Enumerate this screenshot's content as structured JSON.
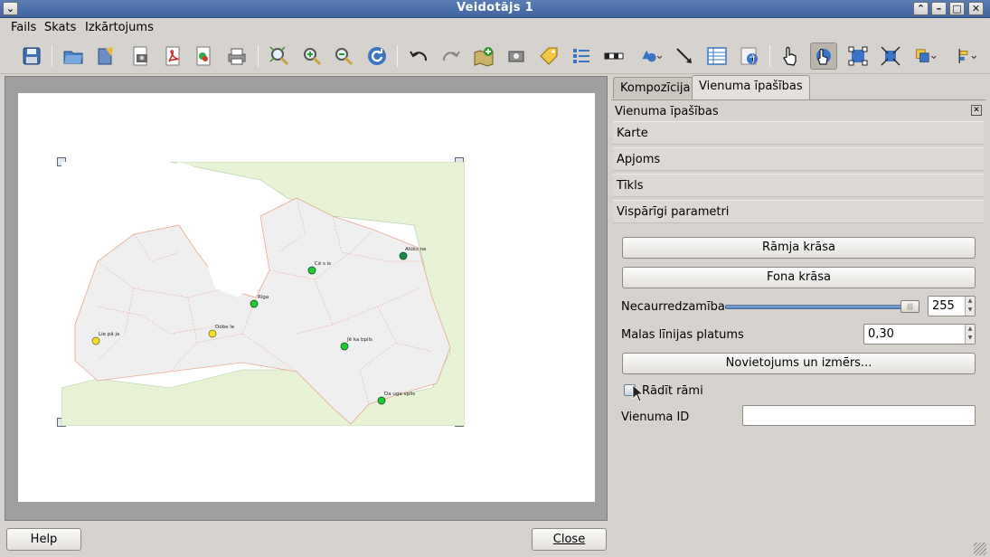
{
  "window": {
    "title": "Veidotājs 1"
  },
  "menu": {
    "items": [
      "Fails",
      "Skats",
      "Izkārtojums"
    ]
  },
  "map": {
    "cities": [
      "Alūks ne",
      "Cē s is",
      "Rīga",
      "Dobe le",
      "Lie pā ja",
      "Jē ka bpils",
      "Da uga vpils"
    ]
  },
  "tabs": {
    "composition": "Kompozīcija",
    "item_props": "Vienuma īpašības"
  },
  "panel": {
    "header": "Vienuma īpašības",
    "sections": [
      "Karte",
      "Apjoms",
      "Tīkls",
      "Vispārīgi parametri"
    ],
    "frame_color_btn": "Rāmja krāsa",
    "bg_color_btn": "Fona krāsa",
    "opacity_label": "Necaurredzamība",
    "opacity_value": "255",
    "outline_label": "Malas līnijas platums",
    "outline_value": "0,30",
    "position_btn": "Novietojums un izmērs...",
    "show_frame_label": "Rādīt rāmi",
    "item_id_label": "Vienuma ID",
    "item_id_value": ""
  },
  "bottom": {
    "help": "Help",
    "close": "Close"
  },
  "colors": {
    "title_bar": "#4a6fa9",
    "city_green": "#1fcc2e",
    "city_yellow": "#f4e02a",
    "city_dark": "#1f8a4c"
  }
}
